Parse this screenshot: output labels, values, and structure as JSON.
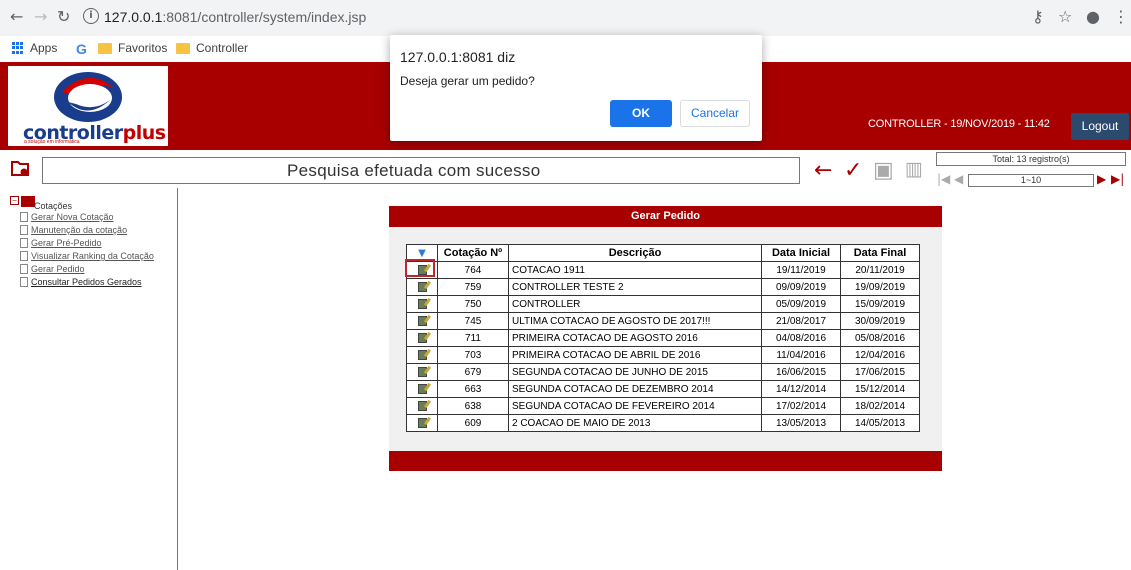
{
  "browser": {
    "back_icon": "arrow-left-icon",
    "forward_icon": "arrow-right-icon",
    "reload_icon": "reload-icon",
    "url_host": "127.0.0.1",
    "url_path": ":8081/controller/system/index.jsp",
    "bookmarks": {
      "apps": "Apps",
      "favoritos": "Favoritos",
      "controller": "Controller"
    }
  },
  "dialog": {
    "title": "127.0.0.1:8081 diz",
    "message": "Deseja gerar um pedido?",
    "ok_label": "OK",
    "cancel_label": "Cancelar"
  },
  "header": {
    "logo_text_1": "controller",
    "logo_text_2": "plus",
    "logo_sub": "a solução em informática",
    "info": "CONTROLLER - 19/NOV/2019 - 11:42",
    "logout_label": "Logout",
    "accent": "#a80000"
  },
  "toolbar": {
    "message": "Pesquisa efetuada com sucesso",
    "total": "Total: 13 registro(s)",
    "page_range": "1~10"
  },
  "sidebar": {
    "root_label": "Cotações",
    "items": [
      {
        "label": "Gerar Nova Cotação"
      },
      {
        "label": "Manutenção da cotação"
      },
      {
        "label": "Gerar Pré-Pedido"
      },
      {
        "label": "Visualizar Ranking da Cotação"
      },
      {
        "label": "Gerar Pedido"
      },
      {
        "label": "Consultar Pedidos Gerados"
      }
    ]
  },
  "panel": {
    "title": "Gerar Pedido",
    "columns": [
      "Cotação Nº",
      "Descrição",
      "Data Inicial",
      "Data Final"
    ],
    "rows": [
      {
        "num": "764",
        "desc": "COTACAO 1911",
        "di": "19/11/2019",
        "df": "20/11/2019"
      },
      {
        "num": "759",
        "desc": "CONTROLLER TESTE 2",
        "di": "09/09/2019",
        "df": "19/09/2019"
      },
      {
        "num": "750",
        "desc": "CONTROLLER",
        "di": "05/09/2019",
        "df": "15/09/2019"
      },
      {
        "num": "745",
        "desc": "ULTIMA COTACAO DE AGOSTO DE 2017!!!",
        "di": "21/08/2017",
        "df": "30/09/2019"
      },
      {
        "num": "711",
        "desc": "PRIMEIRA COTACAO DE AGOSTO 2016",
        "di": "04/08/2016",
        "df": "05/08/2016"
      },
      {
        "num": "703",
        "desc": "PRIMEIRA COTACAO DE ABRIL DE 2016",
        "di": "11/04/2016",
        "df": "12/04/2016"
      },
      {
        "num": "679",
        "desc": "SEGUNDA COTACAO DE JUNHO DE 2015",
        "di": "16/06/2015",
        "df": "17/06/2015"
      },
      {
        "num": "663",
        "desc": "SEGUNDA COTACAO DE DEZEMBRO 2014",
        "di": "14/12/2014",
        "df": "15/12/2014"
      },
      {
        "num": "638",
        "desc": "SEGUNDA COTACAO DE FEVEREIRO 2014",
        "di": "17/02/2014",
        "df": "18/02/2014"
      },
      {
        "num": "609",
        "desc": "2 COACAO DE MAIO DE 2013",
        "di": "13/05/2013",
        "df": "14/05/2013"
      }
    ]
  }
}
